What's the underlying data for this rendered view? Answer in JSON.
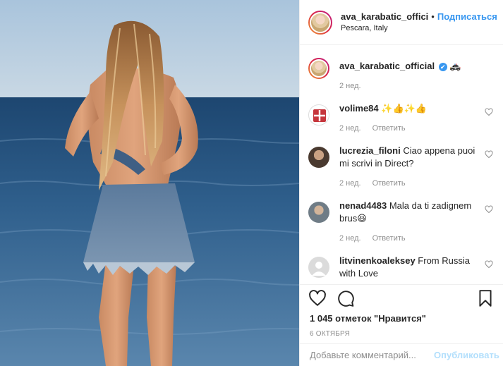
{
  "header": {
    "username": "ava_karabatic_offici",
    "separator": "•",
    "follow_label": "Подписаться",
    "location": "Pescara, Italy"
  },
  "caption": {
    "username": "ava_karabatic_official",
    "verified_icon": "✔",
    "emoji": "🚓",
    "time": "2 нед."
  },
  "comments": [
    {
      "user": "volime84",
      "text": "✨👍✨👍",
      "time": "2 нед.",
      "reply": "Ответить"
    },
    {
      "user": "lucrezia_filoni",
      "text": "Ciao appena puoi mi scrivi in Direct?",
      "time": "2 нед.",
      "reply": "Ответить"
    },
    {
      "user": "nenad4483",
      "text": "Mala da ti zadignem brus😆",
      "time": "2 нед.",
      "reply": "Ответить"
    },
    {
      "user": "litvinenkoaleksey",
      "text": "From Russia with Love",
      "time": "",
      "reply": ""
    }
  ],
  "actions": {
    "icons": [
      "heart-icon",
      "comment-icon",
      "save-icon"
    ],
    "likes": "1 045 отметок \"Нравится\"",
    "date": "6 ОКТЯБРЯ"
  },
  "add_comment": {
    "placeholder": "Добавьте комментарий...",
    "publish_label": "Опубликовать"
  },
  "colors": {
    "link_blue": "#3897f0",
    "meta_gray": "#8e8e8e",
    "publish_disabled": "#b2dffc"
  }
}
